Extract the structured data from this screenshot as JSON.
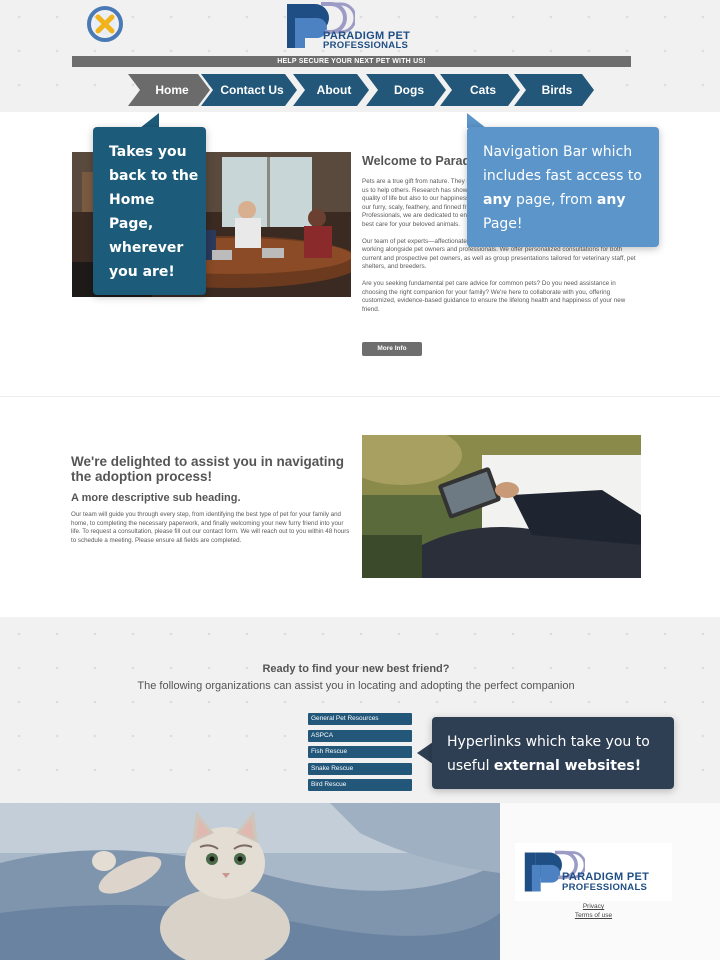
{
  "header": {
    "brand_line1": "PARADIGM PET",
    "brand_line2": "PROFESSIONALS",
    "tagline": "HELP SECURE YOUR NEXT PET WITH US!"
  },
  "nav": {
    "items": [
      {
        "label": "Home",
        "color": "#6b6b6b"
      },
      {
        "label": "Contact Us",
        "color": "#22577a"
      },
      {
        "label": "About",
        "color": "#22577a"
      },
      {
        "label": "Dogs",
        "color": "#22577a"
      },
      {
        "label": "Cats",
        "color": "#22577a"
      },
      {
        "label": "Birds",
        "color": "#22577a"
      }
    ]
  },
  "welcome": {
    "title": "Welcome to Paradigm Pet Professionals",
    "p1": "Pets are a true gift from nature. They have the power to nurture our souls, lift our spirits, and inspire us to help others. Research has shown that well-cared-for pets contribute not only to our overall quality of life but also to our happiness. For this reason, we believe that the bond between you and our furry, scaly, feathery, and finned friends deserves the utmost care. At Paradigm Pet Professionals, we are dedicated to ensuring you have all the information you need to provide the best care for your beloved animals.",
    "p2": "Our team of pet experts—affectionately known as \"Pexperts\"—has spent the past twelve years working alongside pet owners and professionals. We offer personalized consultations for both current and prospective pet owners, as well as group presentations tailored for veterinary staff, pet shelters, and breeders.",
    "p3": "Are you seeking fundamental pet care advice for common pets? Do you need assistance in choosing the right companion for your family? We're here to collaborate with you, offering customized, evidence-based guidance to ensure the lifelong health and happiness of your new friend.",
    "more_info": "More Info"
  },
  "adoption": {
    "title": "We're delighted to assist you in navigating the adoption process!",
    "subheading": "A more descriptive sub heading.",
    "body": "Our team will guide you through every step, from identifying the best type of pet for your family and home, to completing the necessary paperwork, and finally welcoming your new furry friend into your life. To request a consultation, please fill out our contact form. We will reach out to you within 48 hours to schedule a meeting. Please ensure all fields are completed."
  },
  "resources": {
    "title": "Ready to find your new best friend?",
    "subtitle": "The following organizations can assist you in locating and adopting the perfect companion",
    "links": [
      "General Pet Resources",
      "ASPCA",
      "Fish Rescue",
      "Snake Rescue",
      "Bird Rescue"
    ]
  },
  "footer": {
    "brand_line1": "PARADIGM PET",
    "brand_line2": "PROFESSIONALS",
    "privacy": "Privacy",
    "terms": "Terms of use"
  },
  "callouts": {
    "home": "Takes you back to the Home Page, wherever you are!",
    "nav_pre": "Navigation Bar which includes fast access to ",
    "nav_bold1": "any",
    "nav_mid": " page,  from ",
    "nav_bold2": "any",
    "nav_post": " Page!",
    "links_pre": "Hyperlinks which take you to useful ",
    "links_bold": "external websites!"
  },
  "colors": {
    "primary": "#22577a",
    "home_tab": "#6b6b6b",
    "callout_home": "#1c5b79",
    "callout_nav": "#5b95c9",
    "callout_links": "#2e3f53"
  }
}
